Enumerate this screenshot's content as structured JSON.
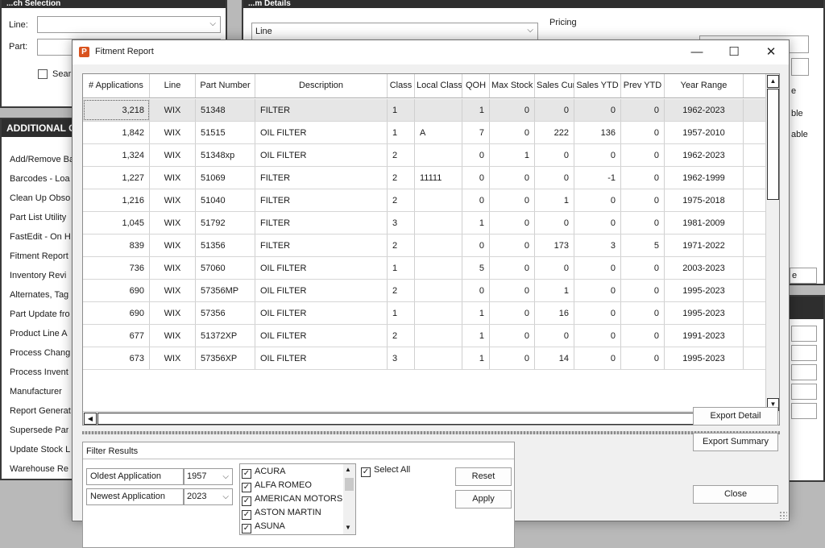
{
  "background": {
    "left_panel_title": "...ch Selection",
    "line_label": "Line:",
    "part_label": "Part:",
    "search_label": "Sear",
    "additional_title": "ADDITIONAL C",
    "additional_items": [
      "Add/Remove Ba",
      "Barcodes - Loa",
      "Clean Up Obso",
      "Part List Utility",
      "FastEdit - On H",
      "Fitment Report",
      "Inventory Revi",
      "Alternates, Tag",
      "Part Update fro",
      "Product Line A",
      "Process Chang",
      "Process Invent",
      "Manufacturer",
      "Report Generat",
      "Supersede Par",
      "Update Stock L",
      "Warehouse Re"
    ],
    "right_panel_title": "...m Details",
    "line_combo_label": "Line",
    "pricing_label": "Pricing",
    "right_fragments": [
      "e",
      "ble",
      "able",
      "e"
    ]
  },
  "dialog": {
    "title": "Fitment Report",
    "minimize": "—",
    "maximize": "☐",
    "close": "✕"
  },
  "grid": {
    "columns": [
      "# Applications",
      "Line",
      "Part Number",
      "Description",
      "Class",
      "Local Class",
      "QOH",
      "Max Stock",
      "Sales Cur",
      "Sales YTD",
      "Prev YTD",
      "Year Range"
    ],
    "rows": [
      [
        "3,218",
        "WIX",
        "51348",
        "FILTER",
        "1",
        "",
        "1",
        "0",
        "0",
        "0",
        "0",
        "1962-2023"
      ],
      [
        "1,842",
        "WIX",
        "51515",
        "OIL FILTER",
        "1",
        "A",
        "7",
        "0",
        "222",
        "136",
        "0",
        "1957-2010"
      ],
      [
        "1,324",
        "WIX",
        "51348xp",
        "OIL FILTER",
        "2",
        "",
        "0",
        "1",
        "0",
        "0",
        "0",
        "1962-2023"
      ],
      [
        "1,227",
        "WIX",
        "51069",
        "FILTER",
        "2",
        "11111",
        "0",
        "0",
        "0",
        "-1",
        "0",
        "1962-1999"
      ],
      [
        "1,216",
        "WIX",
        "51040",
        "FILTER",
        "2",
        "",
        "0",
        "0",
        "1",
        "0",
        "0",
        "1975-2018"
      ],
      [
        "1,045",
        "WIX",
        "51792",
        "FILTER",
        "3",
        "",
        "1",
        "0",
        "0",
        "0",
        "0",
        "1981-2009"
      ],
      [
        "839",
        "WIX",
        "51356",
        "FILTER",
        "2",
        "",
        "0",
        "0",
        "173",
        "3",
        "5",
        "1971-2022"
      ],
      [
        "736",
        "WIX",
        "57060",
        "OIL FILTER",
        "1",
        "",
        "5",
        "0",
        "0",
        "0",
        "0",
        "2003-2023"
      ],
      [
        "690",
        "WIX",
        "57356MP",
        "OIL FILTER",
        "2",
        "",
        "0",
        "0",
        "1",
        "0",
        "0",
        "1995-2023"
      ],
      [
        "690",
        "WIX",
        "57356",
        "OIL FILTER",
        "1",
        "",
        "1",
        "0",
        "16",
        "0",
        "0",
        "1995-2023"
      ],
      [
        "677",
        "WIX",
        "51372XP",
        "OIL FILTER",
        "2",
        "",
        "1",
        "0",
        "0",
        "0",
        "0",
        "1991-2023"
      ],
      [
        "673",
        "WIX",
        "57356XP",
        "OIL FILTER",
        "3",
        "",
        "1",
        "0",
        "14",
        "0",
        "0",
        "1995-2023"
      ]
    ]
  },
  "filter": {
    "title": "Filter Results",
    "oldest_label": "Oldest Application",
    "oldest_value": "1957",
    "newest_label": "Newest Application",
    "newest_value": "2023",
    "makes": [
      "ACURA",
      "ALFA ROMEO",
      "AMERICAN MOTORS",
      "ASTON MARTIN",
      "ASUNA"
    ],
    "check_mark": "✓",
    "select_all": "Select All",
    "reset": "Reset",
    "apply": "Apply"
  },
  "actions": {
    "export_detail": "Export Detail",
    "export_summary": "Export Summary",
    "close": "Close"
  },
  "icons": {
    "app": "P",
    "chevron": "⌵",
    "up": "▲",
    "down": "▼",
    "left": "◀",
    "right": "▶"
  }
}
